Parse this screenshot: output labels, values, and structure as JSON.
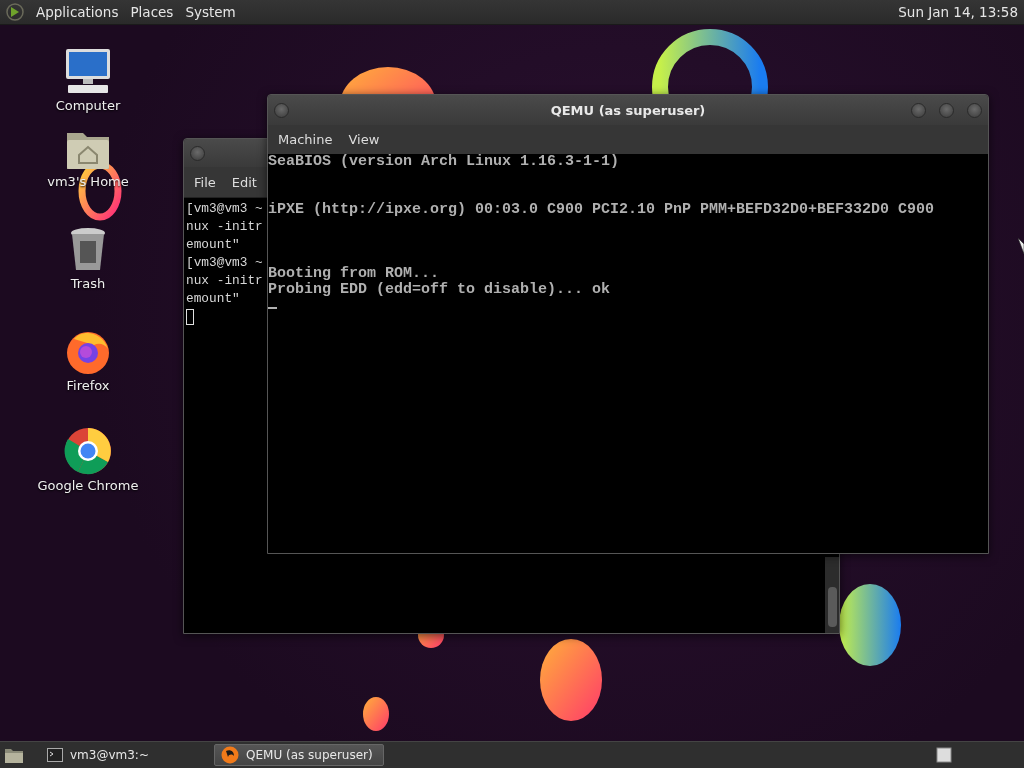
{
  "top_panel": {
    "menus": [
      "Applications",
      "Places",
      "System"
    ],
    "clock": "Sun Jan 14, 13:58"
  },
  "desktop_icons": [
    {
      "label": "Computer",
      "kind": "computer"
    },
    {
      "label": "vm3's Home",
      "kind": "home"
    },
    {
      "label": "Trash",
      "kind": "trash"
    },
    {
      "label": "Firefox",
      "kind": "firefox"
    },
    {
      "label": "Google Chrome",
      "kind": "chrome"
    }
  ],
  "terminal_window": {
    "menus": [
      "File",
      "Edit"
    ],
    "lines": [
      "[vm3@vm3 ~",
      "nux -initr",
      "emount\"",
      "[vm3@vm3 ~",
      "nux -initr",
      "emount\""
    ]
  },
  "qemu_window": {
    "title": "QEMU (as superuser)",
    "menus": [
      "Machine",
      "View"
    ],
    "screen": [
      {
        "kind": "text",
        "text": "SeaBIOS (version Arch Linux 1.16.3-1-1)"
      },
      {
        "kind": "blank"
      },
      {
        "kind": "blank"
      },
      {
        "kind": "text",
        "text": "iPXE (http://ipxe.org) 00:03.0 C900 PCI2.10 PnP PMM+BEFD32D0+BEF332D0 C900"
      },
      {
        "kind": "blank"
      },
      {
        "kind": "blank"
      },
      {
        "kind": "blank"
      },
      {
        "kind": "text",
        "text": "Booting from ROM..."
      },
      {
        "kind": "text",
        "text": "Probing EDD (edd=off to disable)... ok"
      },
      {
        "kind": "cursor"
      }
    ]
  },
  "taskbar": {
    "tasks": [
      {
        "label": "vm3@vm3:~",
        "kind": "terminal",
        "selected": false
      },
      {
        "label": "QEMU (as superuser)",
        "kind": "qemu",
        "selected": true
      }
    ]
  }
}
